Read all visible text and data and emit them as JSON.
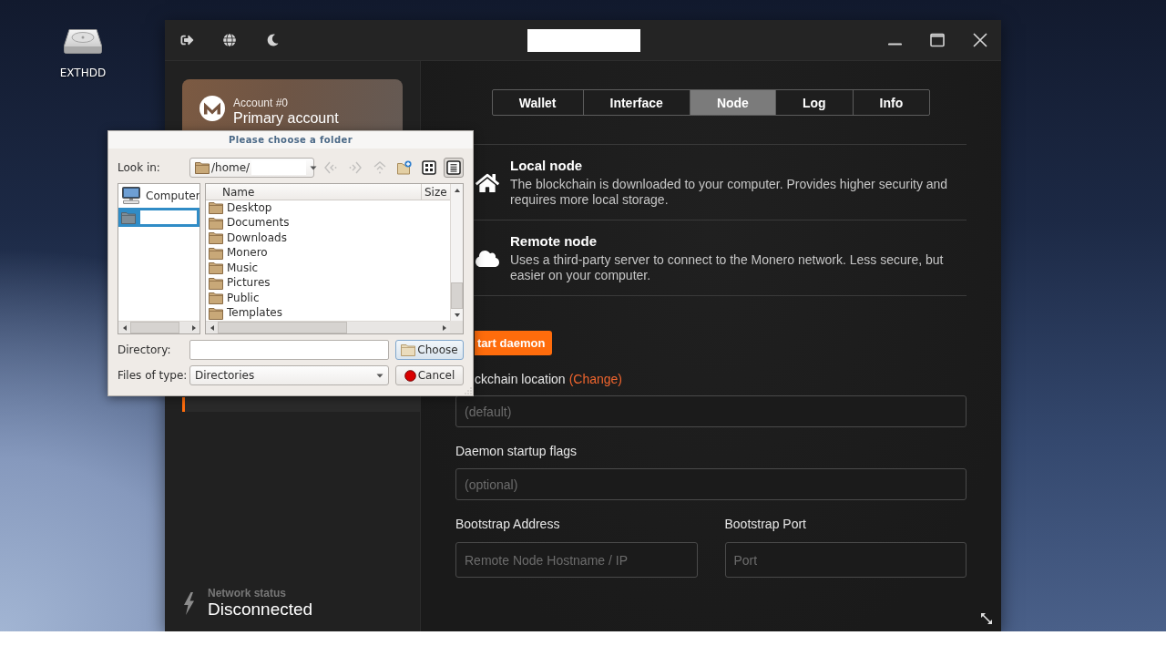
{
  "desktop": {
    "icons": [
      {
        "label": "EXTHDD"
      }
    ]
  },
  "app": {
    "sidebar": {
      "account": {
        "number": "Account #0",
        "name": "Primary account"
      },
      "menu": [
        {
          "selected": true
        }
      ],
      "network_status": {
        "label": "Network status",
        "value": "Disconnected"
      }
    },
    "tabs": [
      {
        "label": "Wallet",
        "selected": false
      },
      {
        "label": "Interface",
        "selected": false
      },
      {
        "label": "Node",
        "selected": true
      },
      {
        "label": "Log",
        "selected": false
      },
      {
        "label": "Info",
        "selected": false
      }
    ],
    "node_modes": [
      {
        "kind": "local",
        "title": "Local node",
        "description": "The blockchain is downloaded to your computer. Provides higher security and requires more local storage."
      },
      {
        "kind": "remote",
        "title": "Remote node",
        "description": "Uses a third-party server to connect to the Monero network. Less secure, but easier on your computer."
      }
    ],
    "start_button": "tart daemon",
    "blockchain_location": {
      "label": "ckchain location",
      "link": "(Change)",
      "placeholder": "(default)"
    },
    "daemon_flags": {
      "label": "Daemon startup flags",
      "placeholder": "(optional)"
    },
    "bootstrap": [
      {
        "label": "Bootstrap Address",
        "placeholder": "Remote Node Hostname / IP"
      },
      {
        "label": "Bootstrap Port",
        "placeholder": "Port"
      }
    ]
  },
  "dialog": {
    "title": "Please choose a folder",
    "look_in": {
      "label": "Look in:",
      "value": "/home/"
    },
    "nav_buttons": [
      {
        "kind": "back",
        "disabled": true
      },
      {
        "kind": "forward",
        "disabled": true
      },
      {
        "kind": "up",
        "disabled": true
      },
      {
        "kind": "new_folder",
        "disabled": false
      }
    ],
    "view_buttons": [
      {
        "kind": "icons",
        "selected": false
      },
      {
        "kind": "details",
        "selected": true
      }
    ],
    "places": [
      {
        "kind": "computer",
        "label": "Computer",
        "selected": false
      },
      {
        "kind": "folder",
        "selected": true
      }
    ],
    "columns": [
      "Name",
      "Size"
    ],
    "files": [
      "Desktop",
      "Documents",
      "Downloads",
      "Monero",
      "Music",
      "Pictures",
      "Public",
      "Templates"
    ],
    "directory": {
      "label": "Directory:"
    },
    "file_type": {
      "label": "Files of type:",
      "value": "Directories"
    },
    "buttons": [
      {
        "kind": "choose",
        "label": "Choose"
      },
      {
        "kind": "cancel",
        "label": "Cancel"
      }
    ]
  }
}
